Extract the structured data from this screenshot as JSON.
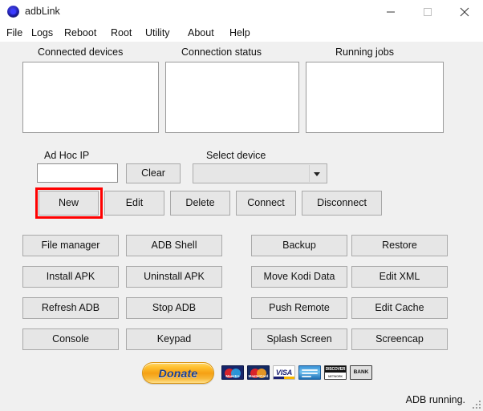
{
  "window": {
    "title": "adbLink",
    "icon": "app-icon",
    "controls": {
      "minimize": "minimize-icon",
      "maximize": "maximize-icon",
      "close": "close-icon"
    }
  },
  "menubar": {
    "items": [
      {
        "label": "File"
      },
      {
        "label": "Logs"
      },
      {
        "label": "Reboot"
      },
      {
        "label": "Root"
      },
      {
        "label": "Utility"
      },
      {
        "label": "About"
      },
      {
        "label": "Help"
      }
    ]
  },
  "panels": [
    {
      "label": "Connected devices",
      "content": ""
    },
    {
      "label": "Connection status",
      "content": ""
    },
    {
      "label": "Running jobs",
      "content": ""
    }
  ],
  "adhoc": {
    "label": "Ad Hoc IP",
    "value": "",
    "placeholder": "",
    "clear_label": "Clear"
  },
  "select_device": {
    "label": "Select device",
    "value": "",
    "options": []
  },
  "action_buttons": [
    {
      "label": "New",
      "highlighted": true
    },
    {
      "label": "Edit",
      "highlighted": false
    },
    {
      "label": "Delete",
      "highlighted": false
    },
    {
      "label": "Connect",
      "highlighted": false
    },
    {
      "label": "Disconnect",
      "highlighted": false
    }
  ],
  "grid_left": [
    {
      "label": "File manager"
    },
    {
      "label": "ADB Shell"
    },
    {
      "label": "Install APK"
    },
    {
      "label": "Uninstall APK"
    },
    {
      "label": "Refresh ADB"
    },
    {
      "label": "Stop ADB"
    },
    {
      "label": "Console"
    },
    {
      "label": "Keypad"
    }
  ],
  "grid_right": [
    {
      "label": "Backup"
    },
    {
      "label": "Restore"
    },
    {
      "label": "Move Kodi Data"
    },
    {
      "label": "Edit XML"
    },
    {
      "label": "Push Remote"
    },
    {
      "label": "Edit Cache"
    },
    {
      "label": "Splash Screen"
    },
    {
      "label": "Screencap"
    }
  ],
  "donate": {
    "label": "Donate",
    "cards": [
      {
        "name": "maestro-card-icon",
        "label": "Maestro"
      },
      {
        "name": "mastercard-card-icon",
        "label": "MasterCard"
      },
      {
        "name": "visa-card-icon",
        "label": "VISA"
      },
      {
        "name": "amex-card-icon",
        "label": "Amex"
      },
      {
        "name": "discover-card-icon",
        "label": "DISCOVER"
      },
      {
        "name": "bank-card-icon",
        "label": "BANK"
      }
    ]
  },
  "statusbar": {
    "text": "ADB running.",
    "grip": "resize-grip-icon"
  },
  "colors": {
    "window_bg": "#f0f0f0",
    "button_face": "#e6e6e6",
    "highlight": "#ff0000",
    "text": "#111111",
    "field_bg": "#ffffff"
  }
}
